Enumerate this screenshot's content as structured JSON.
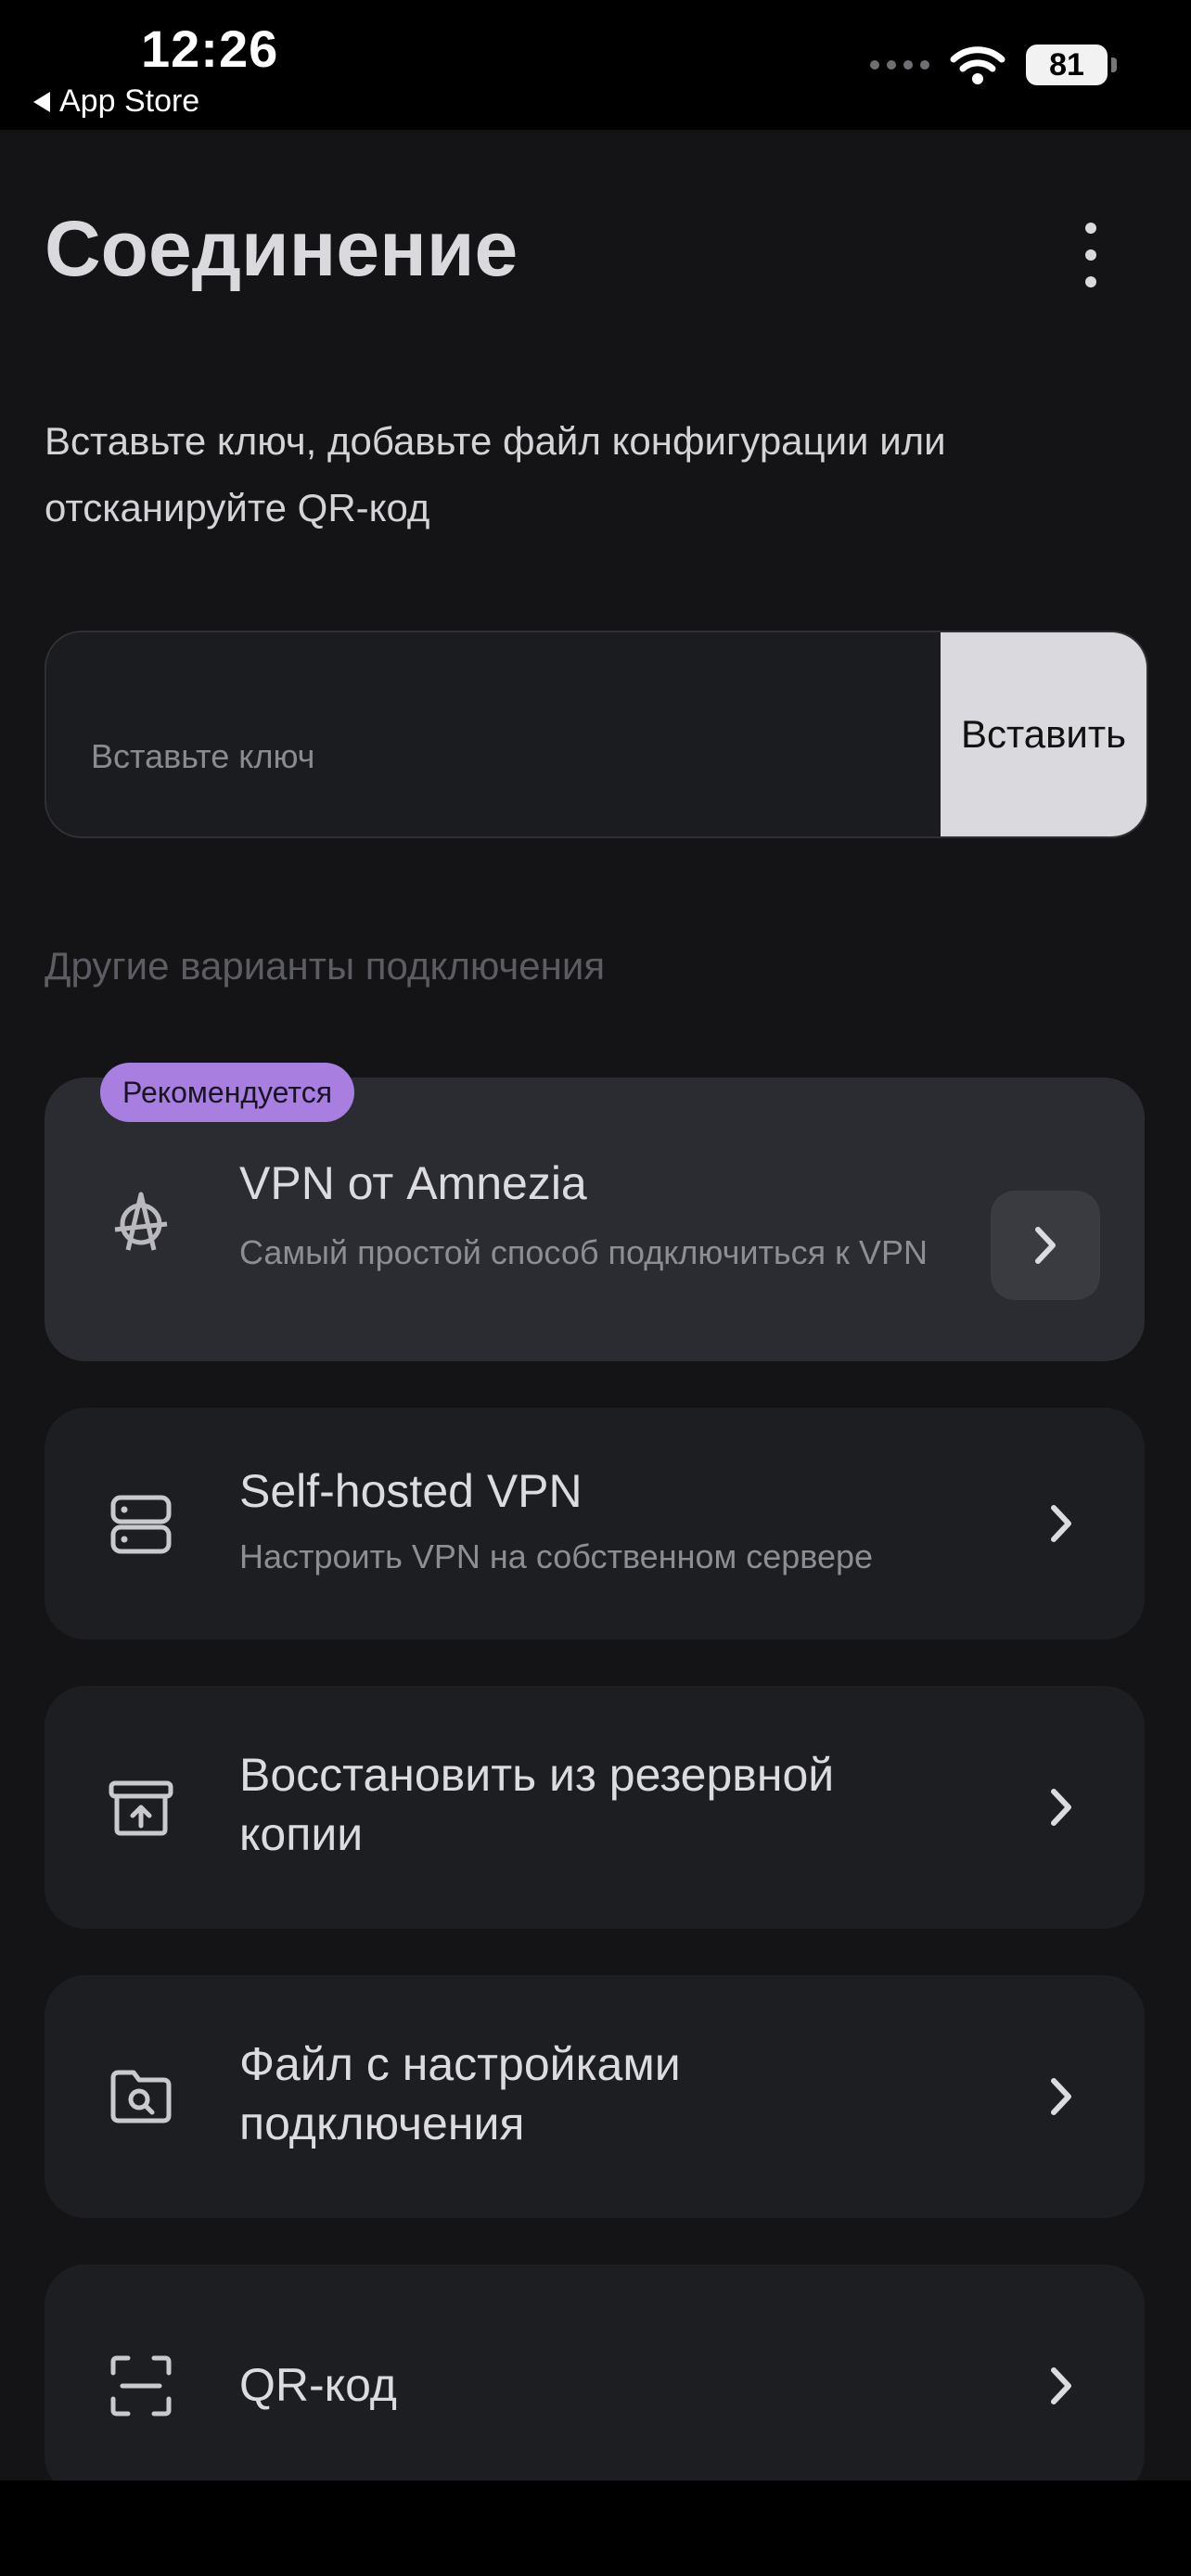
{
  "status_bar": {
    "time": "12:26",
    "back_label": "App Store",
    "battery": "81"
  },
  "page": {
    "title": "Соединение",
    "subtitle": "Вставьте ключ, добавьте файл конфигурации или отсканируйте QR-код"
  },
  "key_input": {
    "placeholder": "Вставьте ключ",
    "button_label": "Вставить"
  },
  "other_options_label": "Другие варианты подключения",
  "options": [
    {
      "badge": "Рекомендуется",
      "title": "VPN от Amnezia",
      "description": "Самый простой способ подключиться к VPN",
      "icon": "amnezia-anarchy-icon"
    },
    {
      "title": "Self-hosted VPN",
      "description": "Настроить VPN на собственном сервере",
      "icon": "server-icon"
    },
    {
      "title": "Восстановить из резервной копии",
      "icon": "backup-restore-icon"
    },
    {
      "title": "Файл с настройками подключения",
      "icon": "folder-search-icon"
    },
    {
      "title": "QR-код",
      "icon": "qr-scan-icon"
    }
  ],
  "colors": {
    "background": "#141417",
    "card": "#1d1e22",
    "card_recommended": "#2b2c31",
    "badge": "#a87fe0",
    "paste_button": "#d9d9de"
  }
}
